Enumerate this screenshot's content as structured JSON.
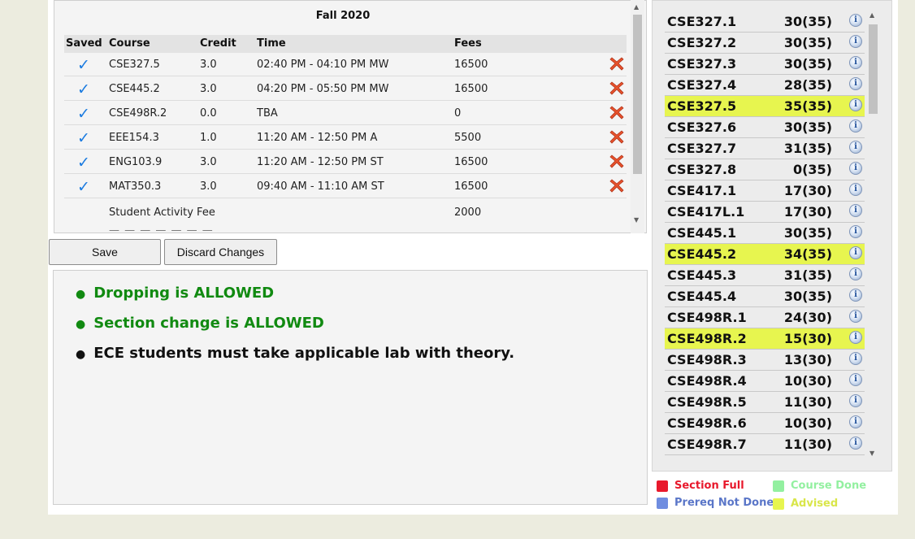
{
  "schedule": {
    "title": "Fall 2020",
    "headers": {
      "saved": "Saved",
      "course": "Course",
      "credit": "Credit",
      "time": "Time",
      "fees": "Fees"
    },
    "rows": [
      {
        "saved": "✓",
        "course": "CSE327.5",
        "credit": "3.0",
        "time": "02:40 PM - 04:10 PM MW",
        "fees": "16500"
      },
      {
        "saved": "✓",
        "course": "CSE445.2",
        "credit": "3.0",
        "time": "04:20 PM - 05:50 PM MW",
        "fees": "16500"
      },
      {
        "saved": "✓",
        "course": "CSE498R.2",
        "credit": "0.0",
        "time": "TBA",
        "fees": "0"
      },
      {
        "saved": "✓",
        "course": "EEE154.3",
        "credit": "1.0",
        "time": "11:20 AM - 12:50 PM A",
        "fees": "5500"
      },
      {
        "saved": "✓",
        "course": "ENG103.9",
        "credit": "3.0",
        "time": "11:20 AM - 12:50 PM ST",
        "fees": "16500"
      },
      {
        "saved": "✓",
        "course": "MAT350.3",
        "credit": "3.0",
        "time": "09:40 AM - 11:10 AM ST",
        "fees": "16500"
      }
    ],
    "extra_fees": [
      {
        "label": "Student Activity Fee",
        "amount": "2000"
      }
    ],
    "remove_icon": "remove-x-icon"
  },
  "buttons": {
    "save": "Save",
    "discard": "Discard Changes"
  },
  "messages": [
    {
      "text": "Dropping is ALLOWED",
      "color": "#118a11"
    },
    {
      "text": "Section change is ALLOWED",
      "color": "#118a11"
    },
    {
      "text": "ECE students must take applicable lab with theory.",
      "color": "#111111"
    }
  ],
  "sections": [
    {
      "name": "CSE327.1",
      "count": "30(35)",
      "advised": false
    },
    {
      "name": "CSE327.2",
      "count": "30(35)",
      "advised": false
    },
    {
      "name": "CSE327.3",
      "count": "30(35)",
      "advised": false
    },
    {
      "name": "CSE327.4",
      "count": "28(35)",
      "advised": false
    },
    {
      "name": "CSE327.5",
      "count": "35(35)",
      "advised": true
    },
    {
      "name": "CSE327.6",
      "count": "30(35)",
      "advised": false
    },
    {
      "name": "CSE327.7",
      "count": "31(35)",
      "advised": false
    },
    {
      "name": "CSE327.8",
      "count": "0(35)",
      "advised": false
    },
    {
      "name": "CSE417.1",
      "count": "17(30)",
      "advised": false
    },
    {
      "name": "CSE417L.1",
      "count": "17(30)",
      "advised": false
    },
    {
      "name": "CSE445.1",
      "count": "30(35)",
      "advised": false
    },
    {
      "name": "CSE445.2",
      "count": "34(35)",
      "advised": true
    },
    {
      "name": "CSE445.3",
      "count": "31(35)",
      "advised": false
    },
    {
      "name": "CSE445.4",
      "count": "30(35)",
      "advised": false
    },
    {
      "name": "CSE498R.1",
      "count": "24(30)",
      "advised": false
    },
    {
      "name": "CSE498R.2",
      "count": "15(30)",
      "advised": true
    },
    {
      "name": "CSE498R.3",
      "count": "13(30)",
      "advised": false
    },
    {
      "name": "CSE498R.4",
      "count": "10(30)",
      "advised": false
    },
    {
      "name": "CSE498R.5",
      "count": "11(30)",
      "advised": false
    },
    {
      "name": "CSE498R.6",
      "count": "10(30)",
      "advised": false
    },
    {
      "name": "CSE498R.7",
      "count": "11(30)",
      "advised": false
    }
  ],
  "legend": [
    {
      "label": "Section Full",
      "color": "#e8192c",
      "text_color": "#e8192c"
    },
    {
      "label": "Course Done",
      "color": "#93f0a0",
      "text_color": "#93f0a0"
    },
    {
      "label": "Prereq Not Done",
      "color": "#6f8de0",
      "text_color": "#5a76c8"
    },
    {
      "label": "Advised",
      "color": "#e7f54f",
      "text_color": "#d9e64a"
    }
  ],
  "colors": {
    "advised": "#e7f54f",
    "check": "#1b7be0",
    "allowed": "#118a11"
  }
}
